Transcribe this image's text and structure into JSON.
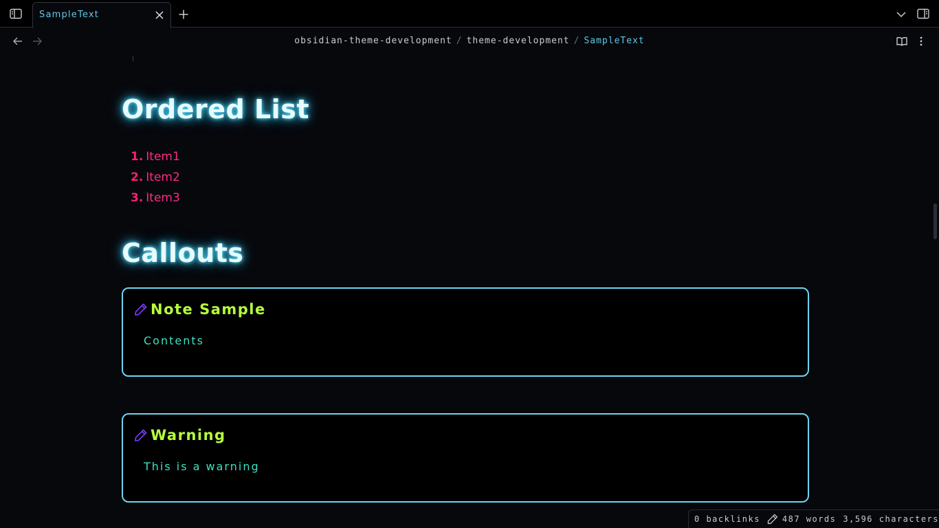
{
  "tabbar": {
    "active_tab": "SampleText"
  },
  "breadcrumb": {
    "items": [
      "obsidian-theme-development",
      "theme-development"
    ],
    "separator": "/",
    "current": "SampleText"
  },
  "content": {
    "ordered_list_heading": "Ordered List",
    "ordered_list": [
      {
        "num": "1.",
        "text": "Item1"
      },
      {
        "num": "2.",
        "text": "Item2"
      },
      {
        "num": "3.",
        "text": "Item3"
      }
    ],
    "callouts_heading": "Callouts",
    "callouts": [
      {
        "title": "Note Sample",
        "body": "Contents",
        "icon": "pencil-icon"
      },
      {
        "title": "Warning",
        "body": "This is a warning",
        "icon": "pencil-icon"
      }
    ]
  },
  "status": {
    "backlinks": "0 backlinks",
    "words": "487 words",
    "characters": "3,596 characters"
  },
  "colors": {
    "accent": "#5fc9e8",
    "heading_glow": "#2fb9e6",
    "list_number": "#ff1f75",
    "list_text": "#ff2a85",
    "callout_border": "#6dd6f2",
    "callout_title": "#b7ff3a",
    "callout_body": "#3fe0c0",
    "callout_icon": "#7a3cff"
  }
}
